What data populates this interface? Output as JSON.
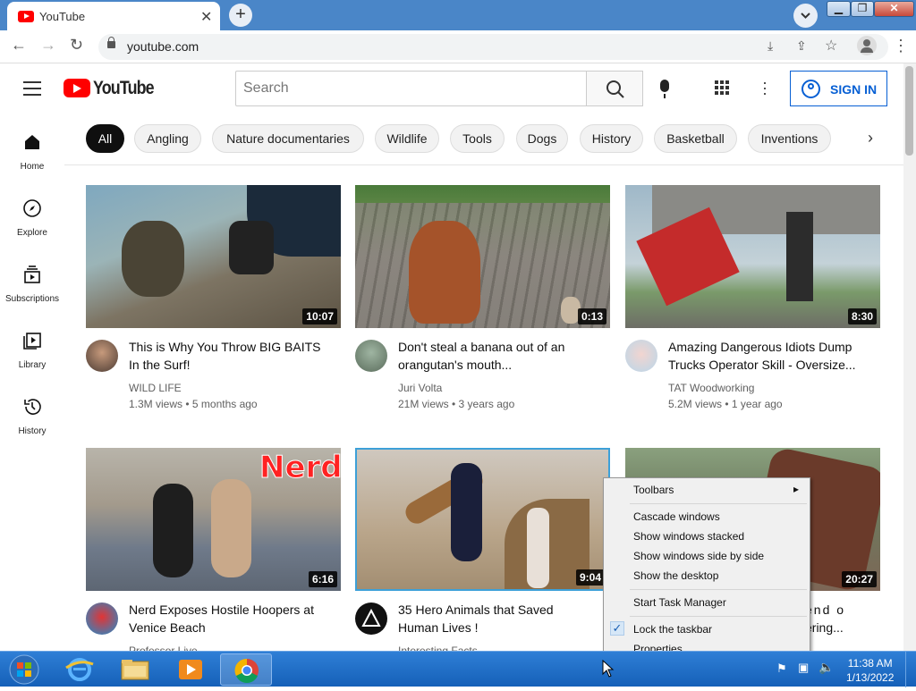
{
  "browser": {
    "tab_title": "YouTube",
    "tab_close": "✕",
    "new_tab": "+",
    "url": "youtube.com",
    "window_controls": {
      "minimize": "▁",
      "maximize": "❐",
      "close": "✕"
    }
  },
  "header": {
    "logo_text": "YouTube",
    "search_placeholder": "Search",
    "signin_label": "SIGN IN"
  },
  "sidebar": {
    "items": [
      {
        "label": "Home",
        "icon": "home-icon"
      },
      {
        "label": "Explore",
        "icon": "compass-icon"
      },
      {
        "label": "Subscriptions",
        "icon": "subscriptions-icon"
      },
      {
        "label": "Library",
        "icon": "library-icon"
      },
      {
        "label": "History",
        "icon": "history-icon"
      }
    ]
  },
  "chips": [
    "All",
    "Angling",
    "Nature documentaries",
    "Wildlife",
    "Tools",
    "Dogs",
    "History",
    "Basketball",
    "Inventions"
  ],
  "videos": [
    {
      "title_line1": "This is Why You Throw BIG BAITS",
      "title_line2": "In the Surf!",
      "channel": "WILD LIFE",
      "meta": "1.3M views • 5 months ago",
      "duration": "10:07"
    },
    {
      "title_line1": "Don't steal a banana out of an",
      "title_line2": "orangutan's mouth...",
      "channel": "Juri Volta",
      "meta": "21M views • 3 years ago",
      "duration": "0:13"
    },
    {
      "title_line1": "Amazing Dangerous Idiots Dump",
      "title_line2": "Trucks Operator Skill - Oversize...",
      "channel": "TAT Woodworking",
      "meta": "5.2M views • 1 year ago",
      "duration": "8:30"
    },
    {
      "title_line1": "Nerd Exposes Hostile Hoopers at",
      "title_line2": "Venice Beach",
      "channel": "Professor Live",
      "meta": "",
      "duration": "6:16",
      "thumb_text": "Nerd"
    },
    {
      "title_line1": "35 Hero Animals that Saved",
      "title_line2": "Human Lives !",
      "channel": "Interesting Facts",
      "meta": "",
      "duration": "9:04"
    },
    {
      "title_line1": "end o",
      "title_line2": "ering...",
      "channel": "",
      "meta": "",
      "duration": "20:27"
    }
  ],
  "context_menu": {
    "items": [
      "Toolbars",
      "Cascade windows",
      "Show windows stacked",
      "Show windows side by side",
      "Show the desktop",
      "Start Task Manager",
      "Lock the taskbar",
      "Properties"
    ],
    "checked": "Lock the taskbar",
    "check_mark": "✓",
    "submenu_arrow": "▸"
  },
  "taskbar": {
    "time": "11:38 AM",
    "date": "1/13/2022"
  },
  "colors": {
    "yt_red": "#ff0000",
    "signin_blue": "#065fd4",
    "taskbar": "#1f6fc8",
    "titlebar": "#4a86c8"
  }
}
